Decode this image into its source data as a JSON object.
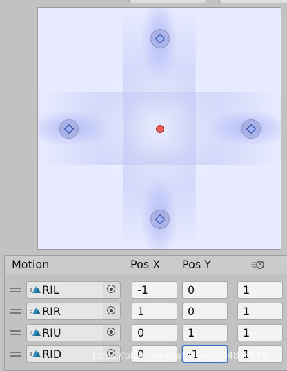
{
  "blend_tree": {
    "nodes": [
      {
        "name": "RIL",
        "pos_x": -1,
        "pos_y": 0
      },
      {
        "name": "RIR",
        "pos_x": 1,
        "pos_y": 0
      },
      {
        "name": "RIU",
        "pos_x": 0,
        "pos_y": 1
      },
      {
        "name": "RID",
        "pos_x": 0,
        "pos_y": -1
      }
    ],
    "current_parameter": {
      "x": 0,
      "y": 0
    }
  },
  "motion_list": {
    "headers": {
      "motion": "Motion",
      "pos_x": "Pos X",
      "pos_y": "Pos Y",
      "speed_icon": "speed-icon"
    },
    "rows": [
      {
        "clip": "RIL",
        "pos_x": "-1",
        "pos_y": "0",
        "speed": "1"
      },
      {
        "clip": "RIR",
        "pos_x": "1",
        "pos_y": "0",
        "speed": "1"
      },
      {
        "clip": "RIU",
        "pos_x": "0",
        "pos_y": "1",
        "speed": "1"
      },
      {
        "clip": "RID",
        "pos_x": "0",
        "pos_y": "-1",
        "speed": "1"
      }
    ]
  },
  "watermark": "https://blog.csdn.net/weixin_44873589",
  "colors": {
    "panel_bg": "#e8ebff",
    "node_diamond": "#9fb4ff",
    "current_position": "#ee5b5b",
    "focus_border": "#3b6fc2"
  }
}
